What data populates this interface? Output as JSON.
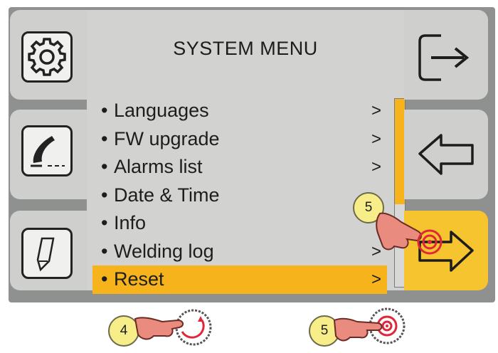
{
  "menu": {
    "title": "SYSTEM MENU",
    "items": [
      {
        "label": "Languages",
        "chevron": ">",
        "selected": false
      },
      {
        "label": "FW upgrade",
        "chevron": ">",
        "selected": false
      },
      {
        "label": "Alarms list",
        "chevron": ">",
        "selected": false
      },
      {
        "label": "Date & Time",
        "chevron": "",
        "selected": false
      },
      {
        "label": "Info",
        "chevron": "",
        "selected": false
      },
      {
        "label": "Welding log",
        "chevron": ">",
        "selected": false
      },
      {
        "label": "Reset",
        "chevron": ">",
        "selected": true
      }
    ],
    "bullet": "•"
  },
  "left_buttons": [
    "gear-icon",
    "welding-torch-icon",
    "pencil-icon"
  ],
  "right_buttons": [
    "exit-arrow-icon",
    "back-arrow-icon",
    "forward-arrow-icon"
  ],
  "callouts": {
    "screen_step": "5",
    "knob_rotate_step": "4",
    "knob_press_step": "5"
  },
  "colors": {
    "accent": "#f6b31b",
    "active_button": "#f6c42e",
    "panel": "#d2d2d0",
    "frame": "#8f9190",
    "callout": "#f7ee8a"
  }
}
